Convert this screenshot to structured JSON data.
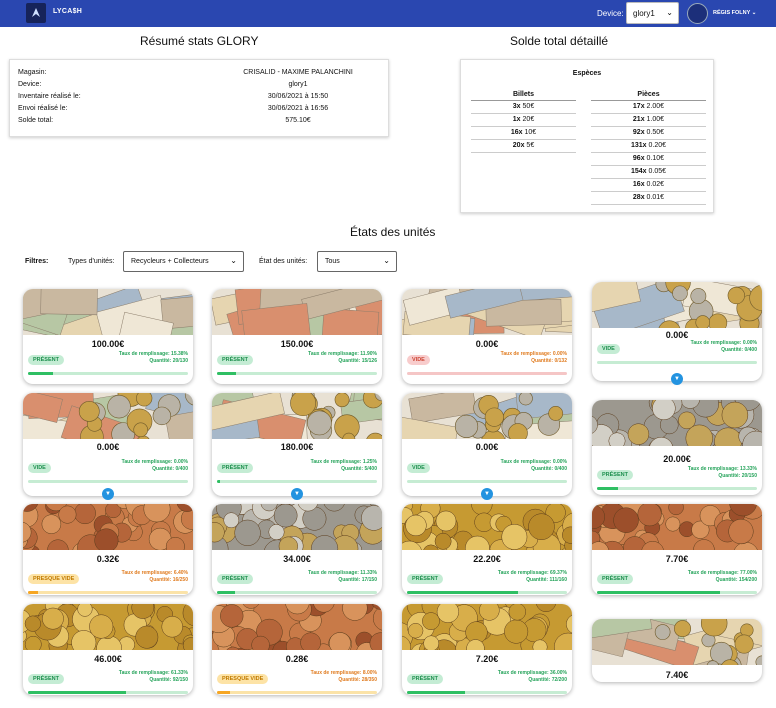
{
  "nav": {
    "brand": "LYCA$H",
    "device_label": "Device:",
    "device_value": "glory1",
    "user": "RÉGIS FOLNY"
  },
  "summary": {
    "title": "Résumé stats GLORY",
    "rows": [
      {
        "k": "Magasin:",
        "v": "CRISALID - MAXIME PALANCHINI"
      },
      {
        "k": "Device:",
        "v": "glory1"
      },
      {
        "k": "Inventaire réalisé le:",
        "v": "30/06/2021 à 15:50"
      },
      {
        "k": "Envoi réalisé le:",
        "v": "30/06/2021 à 16:56"
      },
      {
        "k": "Solde total:",
        "v": "575.10€"
      }
    ]
  },
  "solde": {
    "title": "Solde total détaillé",
    "especes": "Espèces",
    "billets_header": "Billets",
    "pieces_header": "Pièces",
    "billets": [
      {
        "q": "3x",
        "v": "50€"
      },
      {
        "q": "1x",
        "v": "20€"
      },
      {
        "q": "16x",
        "v": "10€"
      },
      {
        "q": "20x",
        "v": "5€"
      }
    ],
    "pieces": [
      {
        "q": "17x",
        "v": "2.00€"
      },
      {
        "q": "21x",
        "v": "1.00€"
      },
      {
        "q": "92x",
        "v": "0.50€"
      },
      {
        "q": "131x",
        "v": "0.20€"
      },
      {
        "q": "96x",
        "v": "0.10€"
      },
      {
        "q": "154x",
        "v": "0.05€"
      },
      {
        "q": "16x",
        "v": "0.02€"
      },
      {
        "q": "28x",
        "v": "0.01€"
      }
    ]
  },
  "units": {
    "title": "États des unités",
    "filters_label": "Filtres:",
    "type_label": "Types d'unités:",
    "type_value": "Recycleurs + Collecteurs",
    "state_label": "État des unités:",
    "state_value": "Tous"
  },
  "colors": {
    "green": "#2fbf63",
    "red": "#f5b3b3",
    "yellow": "#f6a623",
    "blue": "#2a47b0"
  },
  "cards": [
    {
      "amount": "100.00€",
      "badge": "PRÉSENT",
      "status": "green",
      "rate": "Taux de remplissage: 15.38%",
      "qty": "Quantité: 20/130",
      "fill": 0.1538,
      "img": "bills"
    },
    {
      "amount": "150.00€",
      "badge": "PRÉSENT",
      "status": "green",
      "rate": "Taux de remplissage: 11.90%",
      "qty": "Quantité: 15/126",
      "fill": 0.119,
      "img": "bills"
    },
    {
      "amount": "0.00€",
      "badge": "VIDE",
      "status": "red",
      "rate": "Taux de remplissage: 0.00%",
      "qty": "Quantité: 0/132",
      "fill": 0,
      "img": "bills"
    },
    {
      "amount": "0.00€",
      "badge": "VIDE",
      "status": "green",
      "rate": "Taux de remplissage: 0.00%",
      "qty": "Quantité: 0/400",
      "fill": 0,
      "img": "mixed"
    },
    {
      "amount": "0.00€",
      "badge": "VIDE",
      "status": "green",
      "rate": "Taux de remplissage: 0.00%",
      "qty": "Quantité: 0/400",
      "fill": 0,
      "img": "mixed"
    },
    {
      "amount": "180.00€",
      "badge": "PRÉSENT",
      "status": "green",
      "rate": "Taux de remplissage: 1.25%",
      "qty": "Quantité: 5/400",
      "fill": 0.0125,
      "img": "mixed"
    },
    {
      "amount": "0.00€",
      "badge": "VIDE",
      "status": "green",
      "rate": "Taux de remplissage: 0.00%",
      "qty": "Quantité: 0/400",
      "fill": 0,
      "img": "mixed"
    },
    {
      "amount": "20.00€",
      "badge": "PRÉSENT",
      "status": "green",
      "rate": "Taux de remplissage: 13.33%",
      "qty": "Quantité: 20/150",
      "fill": 0.1333,
      "img": "silver"
    },
    {
      "amount": "0.32€",
      "badge": "PRESQUE VIDE",
      "status": "yellow",
      "rate": "Taux de remplissage: 6.40%",
      "qty": "Quantité: 16/250",
      "fill": 0.064,
      "img": "copper"
    },
    {
      "amount": "34.00€",
      "badge": "PRÉSENT",
      "status": "green",
      "rate": "Taux de remplissage: 11.33%",
      "qty": "Quantité: 17/150",
      "fill": 0.1133,
      "img": "silver"
    },
    {
      "amount": "22.20€",
      "badge": "PRÉSENT",
      "status": "green",
      "rate": "Taux de remplissage: 69.37%",
      "qty": "Quantité: 111/160",
      "fill": 0.6937,
      "img": "gold"
    },
    {
      "amount": "7.70€",
      "badge": "PRÉSENT",
      "status": "green",
      "rate": "Taux de remplissage: 77.00%",
      "qty": "Quantité: 154/200",
      "fill": 0.77,
      "img": "copper"
    },
    {
      "amount": "46.00€",
      "badge": "PRÉSENT",
      "status": "green",
      "rate": "Taux de remplissage: 61.33%",
      "qty": "Quantité: 92/150",
      "fill": 0.6133,
      "img": "gold"
    },
    {
      "amount": "0.28€",
      "badge": "PRESQUE VIDE",
      "status": "yellow",
      "rate": "Taux de remplissage: 8.00%",
      "qty": "Quantité: 28/350",
      "fill": 0.08,
      "img": "copper"
    },
    {
      "amount": "7.20€",
      "badge": "PRÉSENT",
      "status": "green",
      "rate": "Taux de remplissage: 36.00%",
      "qty": "Quantité: 72/200",
      "fill": 0.36,
      "img": "gold"
    },
    {
      "amount": "7.40€",
      "img": "mixed"
    }
  ]
}
